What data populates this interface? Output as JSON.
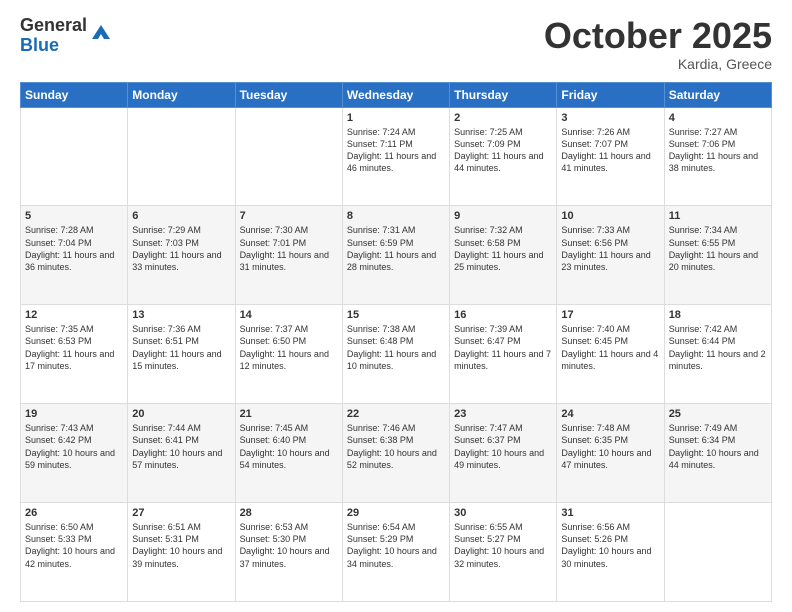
{
  "header": {
    "logo_general": "General",
    "logo_blue": "Blue",
    "month_title": "October 2025",
    "subtitle": "Kardia, Greece"
  },
  "days_of_week": [
    "Sunday",
    "Monday",
    "Tuesday",
    "Wednesday",
    "Thursday",
    "Friday",
    "Saturday"
  ],
  "weeks": [
    [
      {
        "day": "",
        "info": ""
      },
      {
        "day": "",
        "info": ""
      },
      {
        "day": "",
        "info": ""
      },
      {
        "day": "1",
        "info": "Sunrise: 7:24 AM\nSunset: 7:11 PM\nDaylight: 11 hours\nand 46 minutes."
      },
      {
        "day": "2",
        "info": "Sunrise: 7:25 AM\nSunset: 7:09 PM\nDaylight: 11 hours\nand 44 minutes."
      },
      {
        "day": "3",
        "info": "Sunrise: 7:26 AM\nSunset: 7:07 PM\nDaylight: 11 hours\nand 41 minutes."
      },
      {
        "day": "4",
        "info": "Sunrise: 7:27 AM\nSunset: 7:06 PM\nDaylight: 11 hours\nand 38 minutes."
      }
    ],
    [
      {
        "day": "5",
        "info": "Sunrise: 7:28 AM\nSunset: 7:04 PM\nDaylight: 11 hours\nand 36 minutes."
      },
      {
        "day": "6",
        "info": "Sunrise: 7:29 AM\nSunset: 7:03 PM\nDaylight: 11 hours\nand 33 minutes."
      },
      {
        "day": "7",
        "info": "Sunrise: 7:30 AM\nSunset: 7:01 PM\nDaylight: 11 hours\nand 31 minutes."
      },
      {
        "day": "8",
        "info": "Sunrise: 7:31 AM\nSunset: 6:59 PM\nDaylight: 11 hours\nand 28 minutes."
      },
      {
        "day": "9",
        "info": "Sunrise: 7:32 AM\nSunset: 6:58 PM\nDaylight: 11 hours\nand 25 minutes."
      },
      {
        "day": "10",
        "info": "Sunrise: 7:33 AM\nSunset: 6:56 PM\nDaylight: 11 hours\nand 23 minutes."
      },
      {
        "day": "11",
        "info": "Sunrise: 7:34 AM\nSunset: 6:55 PM\nDaylight: 11 hours\nand 20 minutes."
      }
    ],
    [
      {
        "day": "12",
        "info": "Sunrise: 7:35 AM\nSunset: 6:53 PM\nDaylight: 11 hours\nand 17 minutes."
      },
      {
        "day": "13",
        "info": "Sunrise: 7:36 AM\nSunset: 6:51 PM\nDaylight: 11 hours\nand 15 minutes."
      },
      {
        "day": "14",
        "info": "Sunrise: 7:37 AM\nSunset: 6:50 PM\nDaylight: 11 hours\nand 12 minutes."
      },
      {
        "day": "15",
        "info": "Sunrise: 7:38 AM\nSunset: 6:48 PM\nDaylight: 11 hours\nand 10 minutes."
      },
      {
        "day": "16",
        "info": "Sunrise: 7:39 AM\nSunset: 6:47 PM\nDaylight: 11 hours\nand 7 minutes."
      },
      {
        "day": "17",
        "info": "Sunrise: 7:40 AM\nSunset: 6:45 PM\nDaylight: 11 hours\nand 4 minutes."
      },
      {
        "day": "18",
        "info": "Sunrise: 7:42 AM\nSunset: 6:44 PM\nDaylight: 11 hours\nand 2 minutes."
      }
    ],
    [
      {
        "day": "19",
        "info": "Sunrise: 7:43 AM\nSunset: 6:42 PM\nDaylight: 10 hours\nand 59 minutes."
      },
      {
        "day": "20",
        "info": "Sunrise: 7:44 AM\nSunset: 6:41 PM\nDaylight: 10 hours\nand 57 minutes."
      },
      {
        "day": "21",
        "info": "Sunrise: 7:45 AM\nSunset: 6:40 PM\nDaylight: 10 hours\nand 54 minutes."
      },
      {
        "day": "22",
        "info": "Sunrise: 7:46 AM\nSunset: 6:38 PM\nDaylight: 10 hours\nand 52 minutes."
      },
      {
        "day": "23",
        "info": "Sunrise: 7:47 AM\nSunset: 6:37 PM\nDaylight: 10 hours\nand 49 minutes."
      },
      {
        "day": "24",
        "info": "Sunrise: 7:48 AM\nSunset: 6:35 PM\nDaylight: 10 hours\nand 47 minutes."
      },
      {
        "day": "25",
        "info": "Sunrise: 7:49 AM\nSunset: 6:34 PM\nDaylight: 10 hours\nand 44 minutes."
      }
    ],
    [
      {
        "day": "26",
        "info": "Sunrise: 6:50 AM\nSunset: 5:33 PM\nDaylight: 10 hours\nand 42 minutes."
      },
      {
        "day": "27",
        "info": "Sunrise: 6:51 AM\nSunset: 5:31 PM\nDaylight: 10 hours\nand 39 minutes."
      },
      {
        "day": "28",
        "info": "Sunrise: 6:53 AM\nSunset: 5:30 PM\nDaylight: 10 hours\nand 37 minutes."
      },
      {
        "day": "29",
        "info": "Sunrise: 6:54 AM\nSunset: 5:29 PM\nDaylight: 10 hours\nand 34 minutes."
      },
      {
        "day": "30",
        "info": "Sunrise: 6:55 AM\nSunset: 5:27 PM\nDaylight: 10 hours\nand 32 minutes."
      },
      {
        "day": "31",
        "info": "Sunrise: 6:56 AM\nSunset: 5:26 PM\nDaylight: 10 hours\nand 30 minutes."
      },
      {
        "day": "",
        "info": ""
      }
    ]
  ]
}
